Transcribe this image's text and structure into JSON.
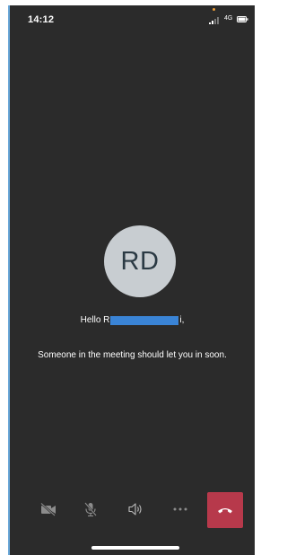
{
  "status_bar": {
    "time": "14:12",
    "network": "4G",
    "icons": [
      "signal-icon",
      "battery-icon"
    ]
  },
  "avatar": {
    "initials": "RD"
  },
  "greeting": {
    "prefix": "Hello R",
    "suffix": "i,"
  },
  "lobby_message": "Someone in the meeting should let you in soon.",
  "controls": {
    "buttons": [
      {
        "name": "camera-off-button",
        "icon": "camera-off-icon"
      },
      {
        "name": "mic-off-button",
        "icon": "mic-off-icon"
      },
      {
        "name": "speaker-button",
        "icon": "speaker-icon"
      },
      {
        "name": "more-options-button",
        "icon": "more-icon"
      },
      {
        "name": "hang-up-button",
        "icon": "hang-up-icon"
      }
    ]
  },
  "colors": {
    "background": "#2b2b2b",
    "avatar": "#c8cdd1",
    "hang_up": "#b7394b",
    "redaction": "#3a84d6"
  }
}
